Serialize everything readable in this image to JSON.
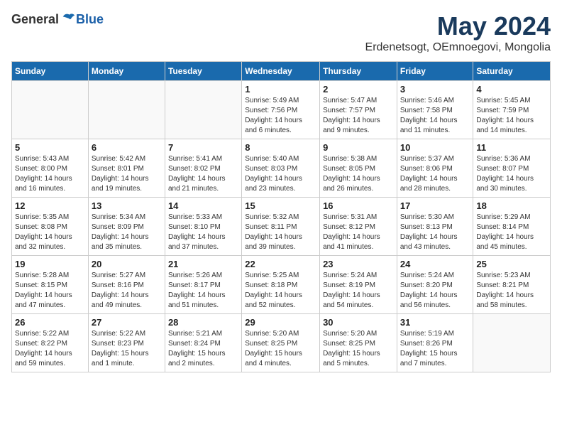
{
  "header": {
    "logo_general": "General",
    "logo_blue": "Blue",
    "month_title": "May 2024",
    "location": "Erdenetsogt, OEmnoegovi, Mongolia"
  },
  "weekdays": [
    "Sunday",
    "Monday",
    "Tuesday",
    "Wednesday",
    "Thursday",
    "Friday",
    "Saturday"
  ],
  "weeks": [
    [
      {
        "day": "",
        "info": ""
      },
      {
        "day": "",
        "info": ""
      },
      {
        "day": "",
        "info": ""
      },
      {
        "day": "1",
        "info": "Sunrise: 5:49 AM\nSunset: 7:56 PM\nDaylight: 14 hours\nand 6 minutes."
      },
      {
        "day": "2",
        "info": "Sunrise: 5:47 AM\nSunset: 7:57 PM\nDaylight: 14 hours\nand 9 minutes."
      },
      {
        "day": "3",
        "info": "Sunrise: 5:46 AM\nSunset: 7:58 PM\nDaylight: 14 hours\nand 11 minutes."
      },
      {
        "day": "4",
        "info": "Sunrise: 5:45 AM\nSunset: 7:59 PM\nDaylight: 14 hours\nand 14 minutes."
      }
    ],
    [
      {
        "day": "5",
        "info": "Sunrise: 5:43 AM\nSunset: 8:00 PM\nDaylight: 14 hours\nand 16 minutes."
      },
      {
        "day": "6",
        "info": "Sunrise: 5:42 AM\nSunset: 8:01 PM\nDaylight: 14 hours\nand 19 minutes."
      },
      {
        "day": "7",
        "info": "Sunrise: 5:41 AM\nSunset: 8:02 PM\nDaylight: 14 hours\nand 21 minutes."
      },
      {
        "day": "8",
        "info": "Sunrise: 5:40 AM\nSunset: 8:03 PM\nDaylight: 14 hours\nand 23 minutes."
      },
      {
        "day": "9",
        "info": "Sunrise: 5:38 AM\nSunset: 8:05 PM\nDaylight: 14 hours\nand 26 minutes."
      },
      {
        "day": "10",
        "info": "Sunrise: 5:37 AM\nSunset: 8:06 PM\nDaylight: 14 hours\nand 28 minutes."
      },
      {
        "day": "11",
        "info": "Sunrise: 5:36 AM\nSunset: 8:07 PM\nDaylight: 14 hours\nand 30 minutes."
      }
    ],
    [
      {
        "day": "12",
        "info": "Sunrise: 5:35 AM\nSunset: 8:08 PM\nDaylight: 14 hours\nand 32 minutes."
      },
      {
        "day": "13",
        "info": "Sunrise: 5:34 AM\nSunset: 8:09 PM\nDaylight: 14 hours\nand 35 minutes."
      },
      {
        "day": "14",
        "info": "Sunrise: 5:33 AM\nSunset: 8:10 PM\nDaylight: 14 hours\nand 37 minutes."
      },
      {
        "day": "15",
        "info": "Sunrise: 5:32 AM\nSunset: 8:11 PM\nDaylight: 14 hours\nand 39 minutes."
      },
      {
        "day": "16",
        "info": "Sunrise: 5:31 AM\nSunset: 8:12 PM\nDaylight: 14 hours\nand 41 minutes."
      },
      {
        "day": "17",
        "info": "Sunrise: 5:30 AM\nSunset: 8:13 PM\nDaylight: 14 hours\nand 43 minutes."
      },
      {
        "day": "18",
        "info": "Sunrise: 5:29 AM\nSunset: 8:14 PM\nDaylight: 14 hours\nand 45 minutes."
      }
    ],
    [
      {
        "day": "19",
        "info": "Sunrise: 5:28 AM\nSunset: 8:15 PM\nDaylight: 14 hours\nand 47 minutes."
      },
      {
        "day": "20",
        "info": "Sunrise: 5:27 AM\nSunset: 8:16 PM\nDaylight: 14 hours\nand 49 minutes."
      },
      {
        "day": "21",
        "info": "Sunrise: 5:26 AM\nSunset: 8:17 PM\nDaylight: 14 hours\nand 51 minutes."
      },
      {
        "day": "22",
        "info": "Sunrise: 5:25 AM\nSunset: 8:18 PM\nDaylight: 14 hours\nand 52 minutes."
      },
      {
        "day": "23",
        "info": "Sunrise: 5:24 AM\nSunset: 8:19 PM\nDaylight: 14 hours\nand 54 minutes."
      },
      {
        "day": "24",
        "info": "Sunrise: 5:24 AM\nSunset: 8:20 PM\nDaylight: 14 hours\nand 56 minutes."
      },
      {
        "day": "25",
        "info": "Sunrise: 5:23 AM\nSunset: 8:21 PM\nDaylight: 14 hours\nand 58 minutes."
      }
    ],
    [
      {
        "day": "26",
        "info": "Sunrise: 5:22 AM\nSunset: 8:22 PM\nDaylight: 14 hours\nand 59 minutes."
      },
      {
        "day": "27",
        "info": "Sunrise: 5:22 AM\nSunset: 8:23 PM\nDaylight: 15 hours\nand 1 minute."
      },
      {
        "day": "28",
        "info": "Sunrise: 5:21 AM\nSunset: 8:24 PM\nDaylight: 15 hours\nand 2 minutes."
      },
      {
        "day": "29",
        "info": "Sunrise: 5:20 AM\nSunset: 8:25 PM\nDaylight: 15 hours\nand 4 minutes."
      },
      {
        "day": "30",
        "info": "Sunrise: 5:20 AM\nSunset: 8:25 PM\nDaylight: 15 hours\nand 5 minutes."
      },
      {
        "day": "31",
        "info": "Sunrise: 5:19 AM\nSunset: 8:26 PM\nDaylight: 15 hours\nand 7 minutes."
      },
      {
        "day": "",
        "info": ""
      }
    ]
  ]
}
